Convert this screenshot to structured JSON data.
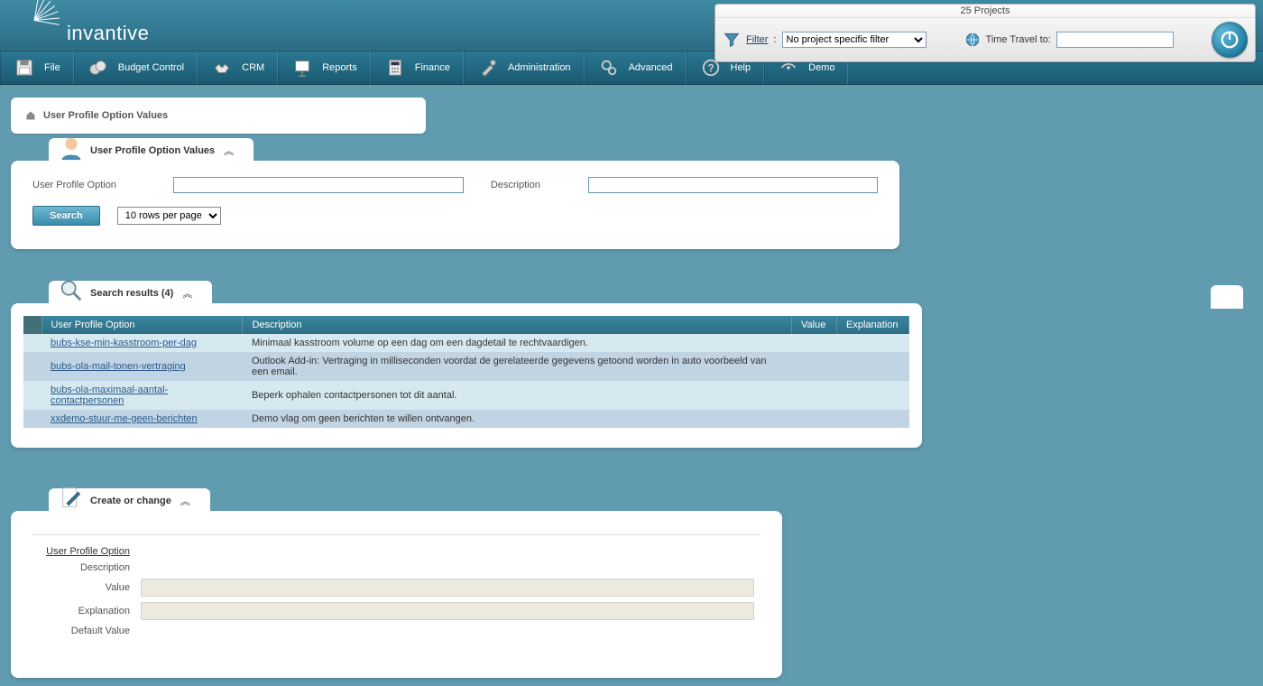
{
  "brand": "invantive",
  "topbar": {
    "projects_label": "25 Projects",
    "filter_label": "Filter",
    "filter_value": "No project specific filter",
    "timetravel_label": "Time Travel to:",
    "timetravel_value": ""
  },
  "menu": [
    {
      "id": "file",
      "label": "File"
    },
    {
      "id": "budget",
      "label": "Budget Control"
    },
    {
      "id": "crm",
      "label": "CRM"
    },
    {
      "id": "reports",
      "label": "Reports"
    },
    {
      "id": "finance",
      "label": "Finance"
    },
    {
      "id": "admin",
      "label": "Administration"
    },
    {
      "id": "advanced",
      "label": "Advanced"
    },
    {
      "id": "help",
      "label": "Help"
    },
    {
      "id": "demo",
      "label": "Demo"
    }
  ],
  "breadcrumb": "User Profile Option Values",
  "search_panel": {
    "title": "User Profile Option Values",
    "opt_label": "User Profile Option",
    "opt_value": "",
    "desc_label": "Description",
    "desc_value": "",
    "search_btn": "Search",
    "rows_per_page": "10 rows per page"
  },
  "results_panel": {
    "title": "Search results (4)",
    "columns": [
      "User Profile Option",
      "Description",
      "Value",
      "Explanation"
    ],
    "rows": [
      {
        "opt": "bubs-kse-min-kasstroom-per-dag",
        "desc": "Minimaal kasstroom volume op een dag om een dagdetail te rechtvaardigen.",
        "val": "",
        "exp": ""
      },
      {
        "opt": "bubs-ola-mail-tonen-vertraging",
        "desc": "Outlook Add-in: Vertraging in milliseconden voordat de gerelateerde gegevens getoond worden in auto voorbeeld van een email.",
        "val": "",
        "exp": ""
      },
      {
        "opt": "bubs-ola-maximaal-aantal-contactpersonen",
        "desc": "Beperk ophalen contactpersonen tot dit aantal.",
        "val": "",
        "exp": ""
      },
      {
        "opt": "xxdemo-stuur-me-geen-berichten",
        "desc": "Demo vlag om geen berichten te willen ontvangen.",
        "val": "",
        "exp": ""
      }
    ]
  },
  "edit_panel": {
    "title": "Create or change",
    "fields": {
      "opt": "User Profile Option",
      "desc": "Description",
      "value": "Value",
      "exp": "Explanation",
      "default": "Default Value"
    }
  }
}
